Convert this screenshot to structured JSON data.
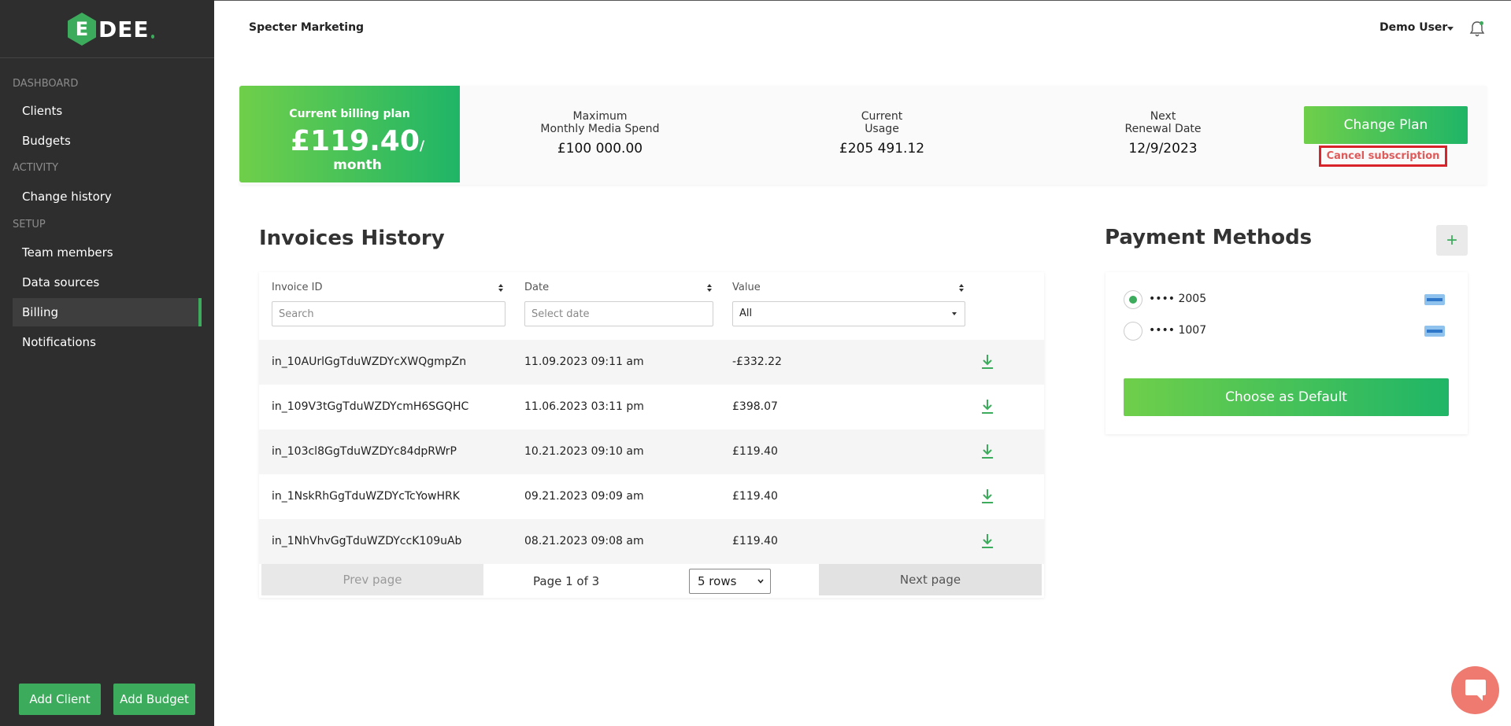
{
  "sidebar": {
    "logo_mark": "E",
    "logo_text": "DEE",
    "sections": {
      "dashboard": "DASHBOARD",
      "activity": "ACTIVITY",
      "setup": "SETUP"
    },
    "items": [
      {
        "label": "Clients"
      },
      {
        "label": "Budgets"
      },
      {
        "label": "Change history"
      },
      {
        "label": "Team members"
      },
      {
        "label": "Data sources"
      },
      {
        "label": "Billing",
        "active": true
      },
      {
        "label": "Notifications"
      }
    ],
    "add_client": "Add Client",
    "add_budget": "Add Budget"
  },
  "header": {
    "company": "Specter Marketing",
    "user": "Demo User"
  },
  "billing": {
    "plan_label": "Current billing plan",
    "plan_amount": "£119.40",
    "plan_period": "/ month",
    "stats": [
      {
        "label_line1": "Maximum",
        "label_line2": "Monthly Media Spend",
        "value": "£100 000.00"
      },
      {
        "label_line1": "Current",
        "label_line2": "Usage",
        "value": "£205 491.12"
      },
      {
        "label_line1": "Next",
        "label_line2": "Renewal Date",
        "value": "12/9/2023"
      }
    ],
    "change_plan": "Change Plan",
    "cancel_subscription": "Cancel subscription"
  },
  "invoices": {
    "title": "Invoices History",
    "columns": {
      "id": "Invoice ID",
      "date": "Date",
      "value": "Value"
    },
    "filters": {
      "id_placeholder": "Search",
      "date_placeholder": "Select date",
      "value_selected": "All"
    },
    "rows": [
      {
        "id": "in_10AUrlGgTduWZDYcXWQgmpZn",
        "date": "11.09.2023 09:11 am",
        "value": "-£332.22"
      },
      {
        "id": "in_109V3tGgTduWZDYcmH6SGQHC",
        "date": "11.06.2023 03:11 pm",
        "value": "£398.07"
      },
      {
        "id": "in_103cl8GgTduWZDYc84dpRWrP",
        "date": "10.21.2023 09:10 am",
        "value": "£119.40"
      },
      {
        "id": "in_1NskRhGgTduWZDYcTcYowHRK",
        "date": "09.21.2023 09:09 am",
        "value": "£119.40"
      },
      {
        "id": "in_1NhVhvGgTduWZDYccK109uAb",
        "date": "08.21.2023 09:08 am",
        "value": "£119.40"
      }
    ],
    "pager": {
      "prev": "Prev page",
      "info": "Page 1 of 3",
      "rows_selected": "5 rows",
      "next": "Next page"
    }
  },
  "payment": {
    "title": "Payment Methods",
    "add": "+",
    "cards": [
      {
        "number": "•••• 2005",
        "selected": true
      },
      {
        "number": "•••• 1007",
        "selected": false
      }
    ],
    "choose_default": "Choose as Default"
  },
  "colors": {
    "brand_green": "#3cab5c",
    "gradient_start": "#6fcf4a",
    "gradient_end": "#1fb567",
    "sidebar_bg": "#2e2e2e",
    "cancel_red": "#d8232a",
    "chat_coral": "#ef7a70"
  },
  "icons": {
    "notifications": "bell-icon",
    "download": "download-icon",
    "sort": "sort-icon",
    "chat": "chat-icon",
    "card_brand": "amex-card-icon"
  }
}
